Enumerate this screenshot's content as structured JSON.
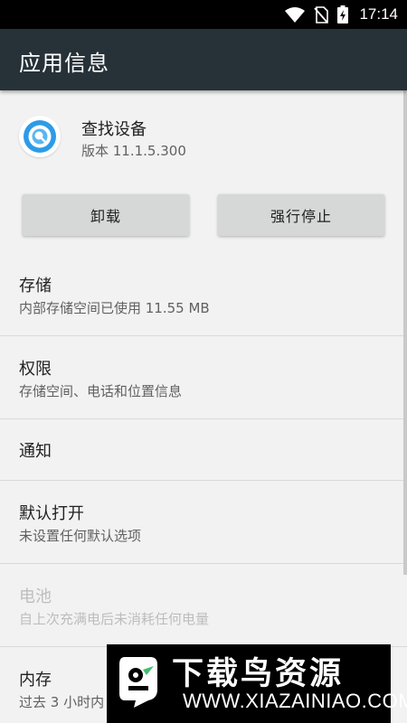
{
  "status_bar": {
    "time": "17:14"
  },
  "app_bar": {
    "title": "应用信息"
  },
  "app": {
    "name": "查找设备",
    "version": "版本 11.1.5.300"
  },
  "buttons": {
    "uninstall": "卸载",
    "force_stop": "强行停止"
  },
  "settings": [
    {
      "title": "存储",
      "subtitle": "内部存储空间已使用 11.55 MB",
      "enabled": true
    },
    {
      "title": "权限",
      "subtitle": "存储空间、电话和位置信息",
      "enabled": true
    },
    {
      "title": "通知",
      "enabled": true
    },
    {
      "title": "默认打开",
      "subtitle": "未设置任何默认选项",
      "enabled": true
    },
    {
      "title": "电池",
      "subtitle": "自上次充满电后未消耗任何电量",
      "enabled": false
    },
    {
      "title": "内存",
      "subtitle": "过去 3 小时内",
      "enabled": true
    }
  ],
  "watermark": {
    "title": "下载鸟资源",
    "url": "WWW.XIAZAINIAO.COM"
  },
  "colors": {
    "app_bar": "#263238",
    "status_bar": "#000000",
    "background": "#f2f2f2",
    "button": "#d6d7d7"
  },
  "icons": [
    "wifi-icon",
    "no-sim-icon",
    "battery-charging-icon",
    "find-device-app-icon",
    "watermark-logo-icon"
  ]
}
